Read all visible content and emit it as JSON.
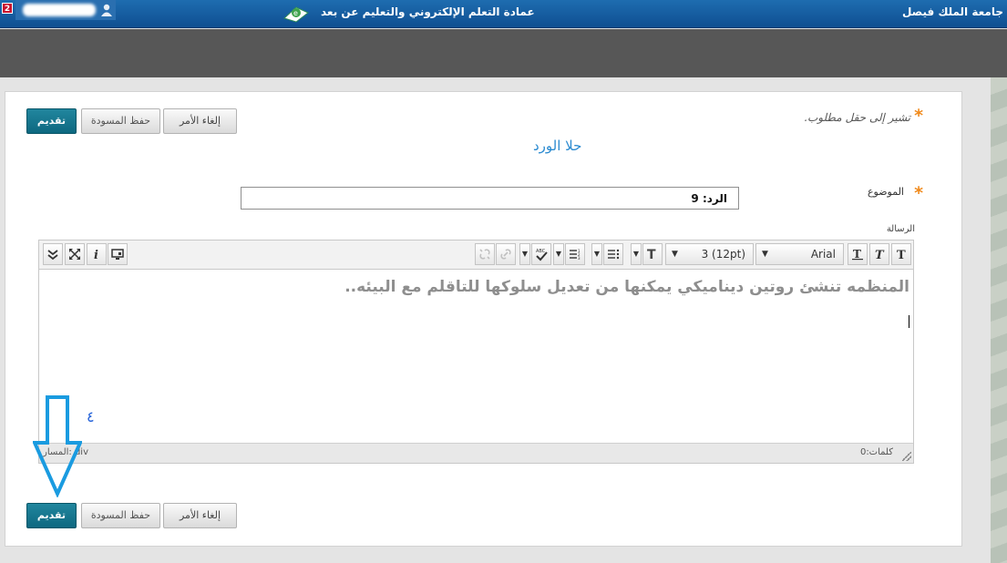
{
  "header": {
    "notification_count": "2",
    "university_name": "جامعة الملك فيصل",
    "deanship_title": "عمادة التعلم الإلكتروني والتعليم عن بعد",
    "logo_icon": "elearning-logo-icon",
    "user_icon": "user-icon"
  },
  "form": {
    "required_note": "تشير إلى حقل مطلوب.",
    "required_star": "*",
    "heading": "حلا الورد",
    "subject_label": "الموضوع",
    "subject_value": "الرد: 9",
    "message_label": "الرسالة"
  },
  "buttons": {
    "submit": "تقديم",
    "save_draft": "حفظ المسودة",
    "cancel": "إلغاء الأمر"
  },
  "toolbar": {
    "font_family": "Arial",
    "font_size": "3 (12pt)",
    "icons": [
      "bold-text-icon",
      "italic-text-icon",
      "underline-text-icon",
      "text-format-icon",
      "bullet-list-icon",
      "numbered-list-icon",
      "spellcheck-icon",
      "link-icon",
      "unlink-icon",
      "preview-icon",
      "info-icon",
      "fullscreen-icon",
      "collapse-icon"
    ]
  },
  "editor": {
    "content": "المنظمه تنشئ روتين ديناميكي يمكنها من تعديل سلوكها للتاقلم مع البيئه..",
    "word_count": "كلمات:0",
    "path": "المسار: div"
  },
  "annotation": {
    "step_number": "٤",
    "arrow_color": "#1a9be0"
  }
}
